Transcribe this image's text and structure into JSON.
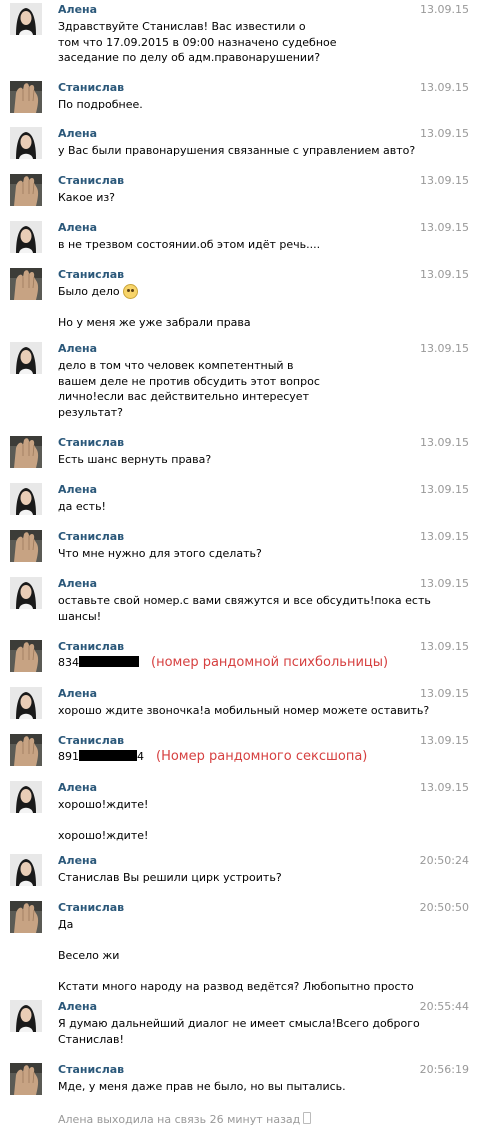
{
  "colors": {
    "name": "#2b587a",
    "time": "#999999",
    "annotation": "#d64040"
  },
  "messages": [
    {
      "sender": "Алена",
      "time": "13.09.15",
      "lines": [
        "Здравствуйте Станислав! Вас известили о",
        "том что 17.09.2015 в 09:00 назначено судебное",
        "заседание по делу об адм.правонарушении?"
      ]
    },
    {
      "sender": "Станислав",
      "time": "13.09.15",
      "lines": [
        "По подробнее."
      ]
    },
    {
      "sender": "Алена",
      "time": "13.09.15",
      "lines": [
        "у Вас были правонарушения связанные с управлением авто?"
      ]
    },
    {
      "sender": "Станислав",
      "time": "13.09.15",
      "lines": [
        "Какое из?"
      ]
    },
    {
      "sender": "Алена",
      "time": "13.09.15",
      "lines": [
        "в не трезвом состоянии.об этом идёт речь...."
      ]
    },
    {
      "sender": "Станислав",
      "time": "13.09.15",
      "lines": [
        "Было дело",
        "",
        "Но у меня же уже забрали права"
      ]
    },
    {
      "sender": "Алена",
      "time": "13.09.15",
      "lines": [
        "дело в том что человек компетентный в",
        "вашем деле не против обсудить этот вопрос",
        "лично!если вас действительно интересует",
        "результат?"
      ]
    },
    {
      "sender": "Станислав",
      "time": "13.09.15",
      "lines": [
        "Есть шанс вернуть права?"
      ]
    },
    {
      "sender": "Алена",
      "time": "13.09.15",
      "lines": [
        "да есть!"
      ]
    },
    {
      "sender": "Станислав",
      "time": "13.09.15",
      "lines": [
        "Что мне нужно для этого сделать?"
      ]
    },
    {
      "sender": "Алена",
      "time": "13.09.15",
      "lines": [
        "оставьте свой номер.с вами свяжутся и все обсудить!пока есть",
        "шансы!"
      ]
    },
    {
      "sender": "Станислав",
      "time": "13.09.15",
      "lines": [
        "834"
      ],
      "annotation": "(номер рандомной психбольницы)"
    },
    {
      "sender": "Алена",
      "time": "13.09.15",
      "lines": [
        "хорошо ждите звоночка!а мобильный номер можете оставить?"
      ]
    },
    {
      "sender": "Станислав",
      "time": "13.09.15",
      "lines": [
        "891"
      ],
      "suffix": "4",
      "annotation": "(Номер рандомного сексшопа)"
    },
    {
      "sender": "Алена",
      "time": "13.09.15",
      "lines": [
        "хорошо!ждите!",
        "",
        "хорошо!ждите!"
      ]
    },
    {
      "sender": "Алена",
      "time": "20:50:24",
      "lines": [
        "Станислав Вы решили цирк устроить?"
      ]
    },
    {
      "sender": "Станислав",
      "time": "20:50:50",
      "lines": [
        "Да",
        "",
        "Весело жи",
        "",
        "Кстати много народу на развод ведётся? Любопытно просто"
      ]
    },
    {
      "sender": "Алена",
      "time": "20:55:44",
      "lines": [
        "Я думаю дальнейший диалог не имеет смысла!Всего доброго",
        "Станислав!"
      ]
    },
    {
      "sender": "Станислав",
      "time": "20:56:19",
      "lines": [
        "Мде, у меня даже прав не было, но вы пытались."
      ]
    }
  ],
  "footer": {
    "status": "Алена выходила на связь 26 минут назад"
  },
  "icons": {
    "emoji": "rolling-eyes-emoji-icon",
    "phone": "mobile-phone-icon"
  }
}
